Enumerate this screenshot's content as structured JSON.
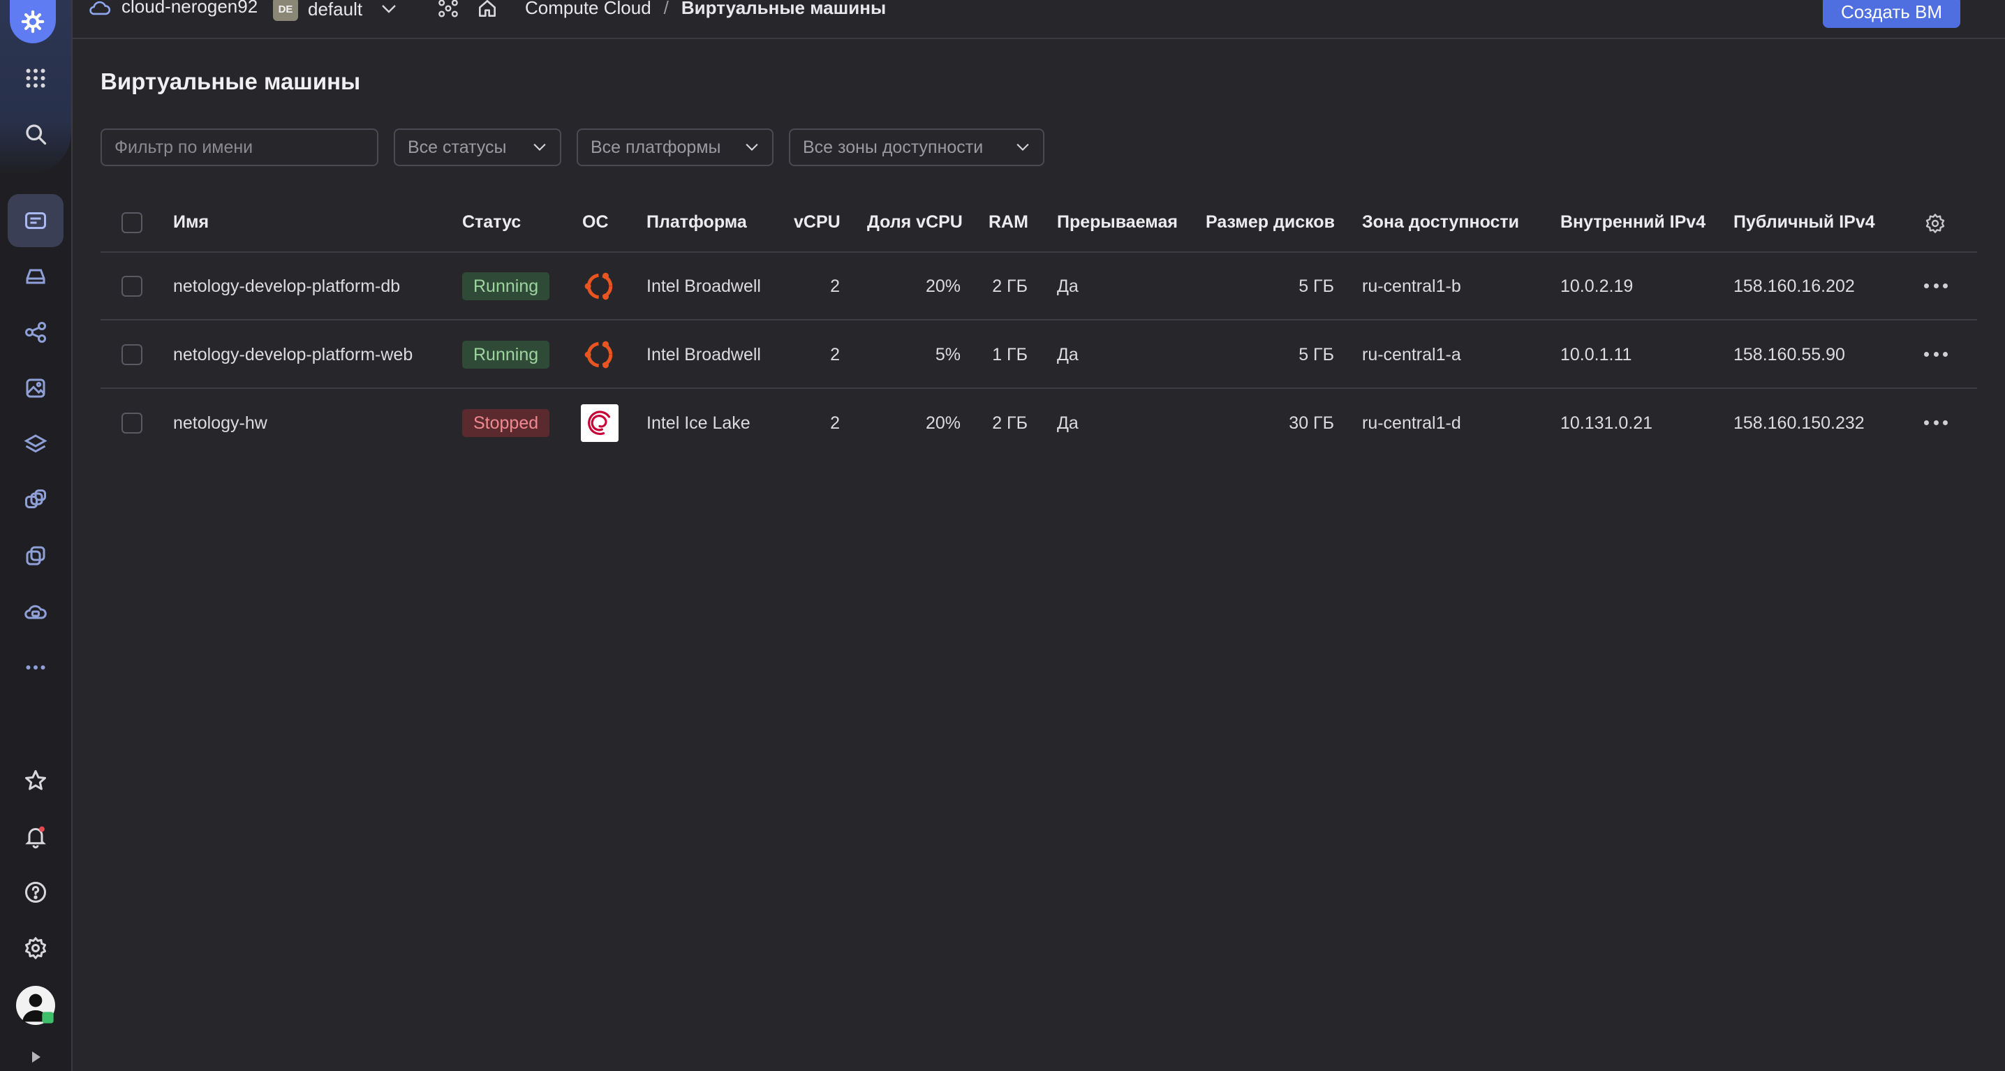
{
  "header": {
    "cloud_name": "cloud-nerogen92",
    "folder_badge": "DE",
    "folder_name": "default",
    "breadcrumb_service": "Compute Cloud",
    "breadcrumb_separator": "/",
    "breadcrumb_page": "Виртуальные машины",
    "create_button": "Создать ВМ"
  },
  "rail": {
    "icons": [
      "yandex-cloud-logo-icon",
      "services-grid-icon",
      "search-icon",
      "compute-icon",
      "disk-icon",
      "network-icon",
      "image-icon",
      "layers-icon",
      "instance-groups-icon",
      "snapshots-icon",
      "cloud-backup-icon",
      "more-icon",
      "favorites-star-icon",
      "notifications-bell-icon",
      "help-icon",
      "settings-gear-icon",
      "user-avatar",
      "expand-panel-icon"
    ]
  },
  "page": {
    "title": "Виртуальные машины",
    "filter_placeholder": "Фильтр по имени",
    "status_select": "Все статусы",
    "platform_select": "Все платформы",
    "zone_select": "Все зоны доступности"
  },
  "table": {
    "columns": [
      "Имя",
      "Статус",
      "ОС",
      "Платформа",
      "vCPU",
      "Доля vCPU",
      "RAM",
      "Прерываемая",
      "Размер дисков",
      "Зона доступности",
      "Внутренний IPv4",
      "Публичный IPv4"
    ],
    "rows": [
      {
        "name": "netology-develop-platform-db",
        "status": "Running",
        "os": "ubuntu",
        "platform": "Intel Broadwell",
        "vcpu": "2",
        "vcpu_share": "20%",
        "ram": "2 ГБ",
        "preemptible": "Да",
        "disk": "5 ГБ",
        "zone": "ru-central1-b",
        "internal_ip": "10.0.2.19",
        "public_ip": "158.160.16.202"
      },
      {
        "name": "netology-develop-platform-web",
        "status": "Running",
        "os": "ubuntu",
        "platform": "Intel Broadwell",
        "vcpu": "2",
        "vcpu_share": "5%",
        "ram": "1 ГБ",
        "preemptible": "Да",
        "disk": "5 ГБ",
        "zone": "ru-central1-a",
        "internal_ip": "10.0.1.11",
        "public_ip": "158.160.55.90"
      },
      {
        "name": "netology-hw",
        "status": "Stopped",
        "os": "debian",
        "platform": "Intel Ice Lake",
        "vcpu": "2",
        "vcpu_share": "20%",
        "ram": "2 ГБ",
        "preemptible": "Да",
        "disk": "30 ГБ",
        "zone": "ru-central1-d",
        "internal_ip": "10.131.0.21",
        "public_ip": "158.160.150.232"
      }
    ]
  },
  "colors": {
    "accent": "#4f6fe0",
    "running_bg": "#2f4a36",
    "running_text": "#9ed49f",
    "stopped_bg": "#5a2a2e",
    "stopped_text": "#f08890",
    "ubuntu": "#e95420"
  }
}
